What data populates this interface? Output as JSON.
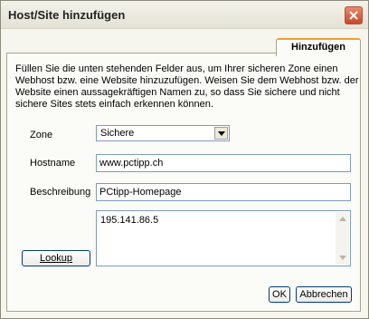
{
  "window": {
    "title": "Host/Site hinzufügen"
  },
  "tab": {
    "label": "Hinzufügen"
  },
  "description": "Füllen Sie die unten stehenden Felder aus, um Ihrer sicheren Zone einen Webhost bzw. eine Website hinzuzufügen. Weisen Sie dem Webhost bzw. der Website einen aussagekräftigen Namen zu, so dass Sie sichere und nicht sichere Sites stets einfach erkennen können.",
  "form": {
    "zone_label": "Zone",
    "zone_value": "Sichere",
    "hostname_label": "Hostname",
    "hostname_value": "www.pctipp.ch",
    "beschreibung_label": "Beschreibung",
    "beschreibung_value": "PCtipp-Homepage",
    "ip_value": "195.141.86.5"
  },
  "buttons": {
    "lookup": "Lookup",
    "ok": "OK",
    "cancel": "Abbrechen"
  }
}
